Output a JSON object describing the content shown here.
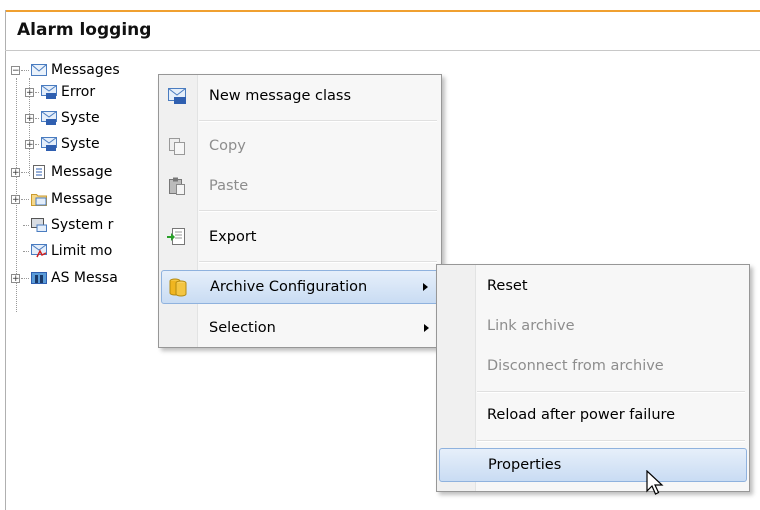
{
  "header": {
    "title": "Alarm logging"
  },
  "tree": {
    "items": [
      {
        "label": "Messages",
        "icon": "envelope-icon",
        "expander": "minus"
      },
      {
        "label": "Error",
        "icon": "message-class-icon",
        "expander": "plus"
      },
      {
        "label": "Syste",
        "icon": "message-class-icon",
        "expander": "plus"
      },
      {
        "label": "Syste",
        "icon": "message-class-icon",
        "expander": "plus"
      },
      {
        "label": "Message",
        "icon": "list-icon",
        "expander": "plus"
      },
      {
        "label": "Message",
        "icon": "folder-envelope-icon",
        "expander": "plus"
      },
      {
        "label": "System r",
        "icon": "system-message-icon",
        "expander": "none"
      },
      {
        "label": "Limit mo",
        "icon": "limit-monitoring-icon",
        "expander": "none"
      },
      {
        "label": "AS Messa",
        "icon": "as-message-icon",
        "expander": "plus"
      }
    ]
  },
  "context_menu": {
    "items": [
      {
        "label": "New message class",
        "icon": "new-message-class-icon"
      },
      {
        "label": "Copy",
        "icon": "copy-icon",
        "disabled": true
      },
      {
        "label": "Paste",
        "icon": "paste-icon",
        "disabled": true
      },
      {
        "label": "Export",
        "icon": "export-icon"
      },
      {
        "label": "Archive Configuration",
        "icon": "archive-icon"
      },
      {
        "label": "Selection",
        "icon": ""
      }
    ]
  },
  "submenu": {
    "items": [
      {
        "label": "Reset"
      },
      {
        "label": "Link archive",
        "disabled": true
      },
      {
        "label": "Disconnect from archive",
        "disabled": true
      },
      {
        "label": "Reload after power failure"
      },
      {
        "label": "Properties"
      }
    ]
  },
  "colors": {
    "accent_rule": "#f0a030",
    "highlight": "#c9dcf3",
    "disabled_text": "#8d8d8d"
  }
}
